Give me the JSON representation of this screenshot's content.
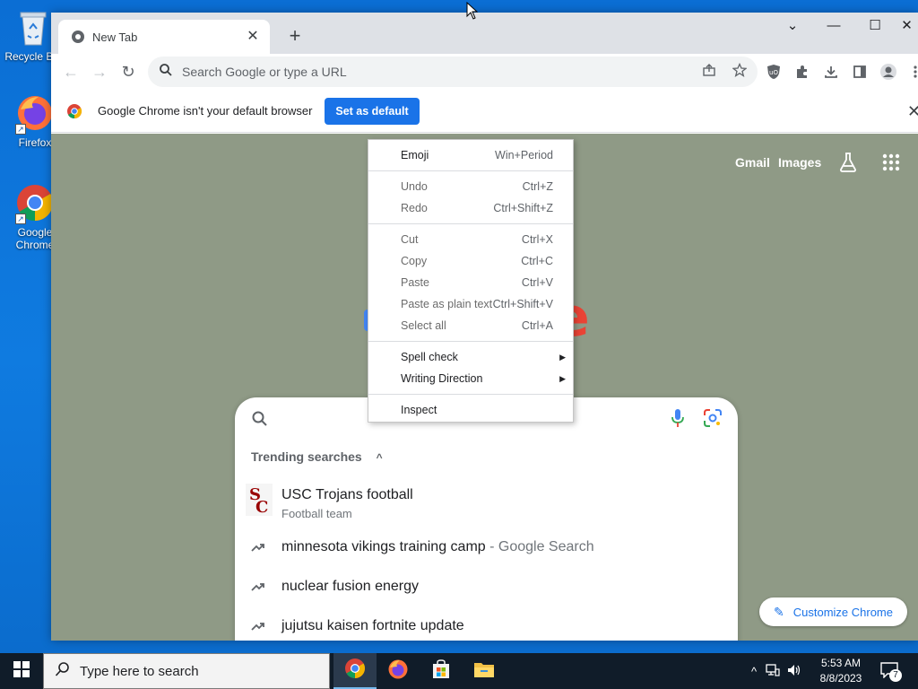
{
  "desktop": {
    "icons": [
      {
        "label": "Recycle Bin",
        "icon": "recycle-bin-icon"
      },
      {
        "label": "Firefox",
        "icon": "firefox-icon"
      },
      {
        "label": "Google\nChrome",
        "icon": "chrome-icon"
      }
    ]
  },
  "browser": {
    "tab": {
      "title": "New Tab",
      "close_glyph": "✕"
    },
    "new_tab_glyph": "+",
    "window_controls": {
      "tab_search": "⌄",
      "minimize": "—",
      "maximize": "☐",
      "close": "✕"
    },
    "omnibox": {
      "placeholder": "Search Google or type a URL"
    },
    "infobar": {
      "message": "Google Chrome isn't your default browser",
      "button": "Set as default",
      "close_glyph": "✕"
    }
  },
  "ntp": {
    "links": {
      "gmail": "Gmail",
      "images": "Images"
    },
    "logo_fragment": "e",
    "trending": {
      "heading": "Trending searches",
      "caret": "^",
      "items": [
        {
          "text": "USC Trojans football",
          "desc": "Football team",
          "icon": "usc-logo"
        },
        {
          "text": "minnesota vikings training camp",
          "sub": " - Google Search",
          "icon": "trending-icon"
        },
        {
          "text": "nuclear fusion energy",
          "icon": "trending-icon"
        },
        {
          "text": "jujutsu kaisen fortnite update",
          "icon": "trending-icon"
        }
      ]
    },
    "customize_label": "Customize Chrome"
  },
  "context_menu": {
    "groups": [
      [
        {
          "label": "Emoji",
          "shortcut": "Win+Period"
        }
      ],
      [
        {
          "label": "Undo",
          "shortcut": "Ctrl+Z"
        },
        {
          "label": "Redo",
          "shortcut": "Ctrl+Shift+Z"
        }
      ],
      [
        {
          "label": "Cut",
          "shortcut": "Ctrl+X"
        },
        {
          "label": "Copy",
          "shortcut": "Ctrl+C"
        },
        {
          "label": "Paste",
          "shortcut": "Ctrl+V"
        },
        {
          "label": "Paste as plain text",
          "shortcut": "Ctrl+Shift+V"
        },
        {
          "label": "Select all",
          "shortcut": "Ctrl+A"
        }
      ],
      [
        {
          "label": "Spell check",
          "submenu": true
        },
        {
          "label": "Writing Direction",
          "submenu": true
        }
      ],
      [
        {
          "label": "Inspect"
        }
      ]
    ]
  },
  "taskbar": {
    "search_placeholder": "Type here to search",
    "apps": [
      "chrome-icon",
      "firefox-icon",
      "store-icon",
      "file-explorer-icon"
    ],
    "clock": {
      "time": "5:53 AM",
      "date": "8/8/2023"
    },
    "notification_count": "7"
  },
  "colors": {
    "accent": "#1a73e8",
    "ntp_background": "#8f9a86",
    "desktop": "#0b6ed4",
    "taskbar": "#101c29"
  }
}
